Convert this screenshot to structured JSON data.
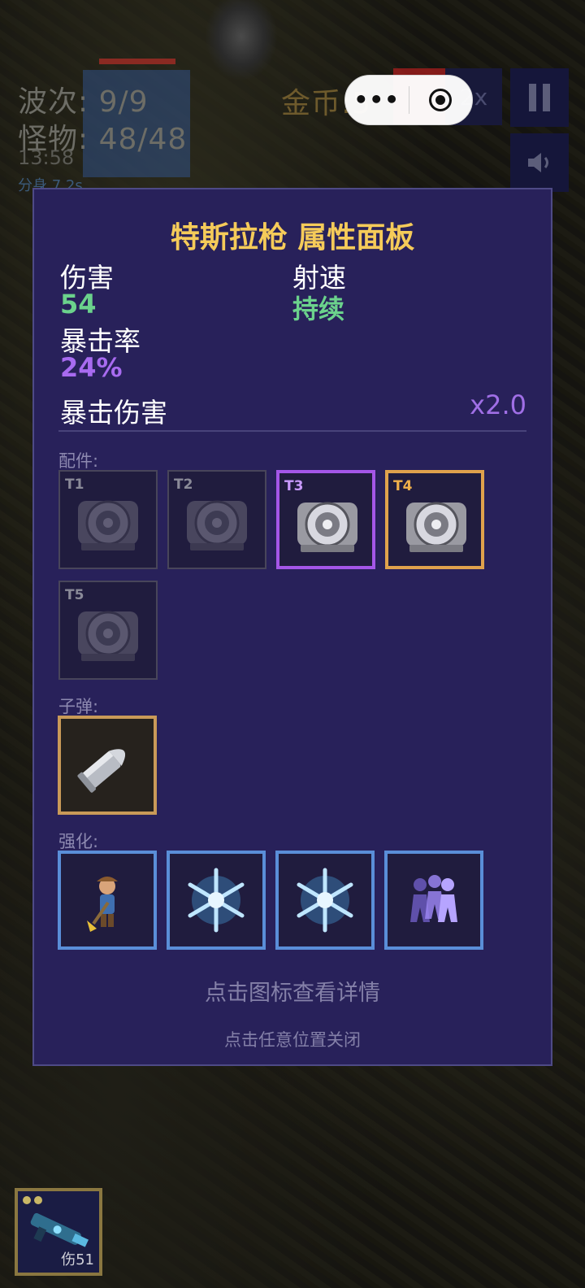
{
  "hud": {
    "wave": "波次: 9/9",
    "monsters": "怪物: 48/48",
    "timer": "13:58",
    "split": "分身 7.2s",
    "gold": "金币:5",
    "speed": "2x"
  },
  "panel": {
    "title": "特斯拉枪 属性面板",
    "damage_label": "伤害",
    "damage_value": "54",
    "fire_rate_label": "射速",
    "fire_rate_value": "持续",
    "crit_rate_label": "暴击率",
    "crit_rate_value": "24%",
    "crit_damage_label": "暴击伤害",
    "crit_damage_value": "x2.0",
    "parts_label": "配件:",
    "parts": [
      {
        "tier": "T1",
        "state": "locked"
      },
      {
        "tier": "T2",
        "state": "locked"
      },
      {
        "tier": "T3",
        "state": "epic"
      },
      {
        "tier": "T4",
        "state": "legendary"
      },
      {
        "tier": "T5",
        "state": "locked"
      }
    ],
    "bullet_label": "子弹:",
    "bullet_icon": "silver-bullet-icon",
    "enhance_label": "强化:",
    "enhancements": [
      "miner-icon",
      "snowflake-icon",
      "snowflake-icon",
      "clone-figures-icon"
    ],
    "hint_detail": "点击图标查看详情",
    "hint_close": "点击任意位置关闭"
  },
  "weapon": {
    "damage": "伤51",
    "icon": "tesla-gun-icon"
  },
  "colors": {
    "panel_bg": "#28215a",
    "title": "#f5cb59",
    "green": "#6bd28c",
    "purple": "#a86bf0",
    "epic_border": "#a456e8",
    "legendary_border": "#e0a24c",
    "buff_border": "#5a8ed8"
  }
}
